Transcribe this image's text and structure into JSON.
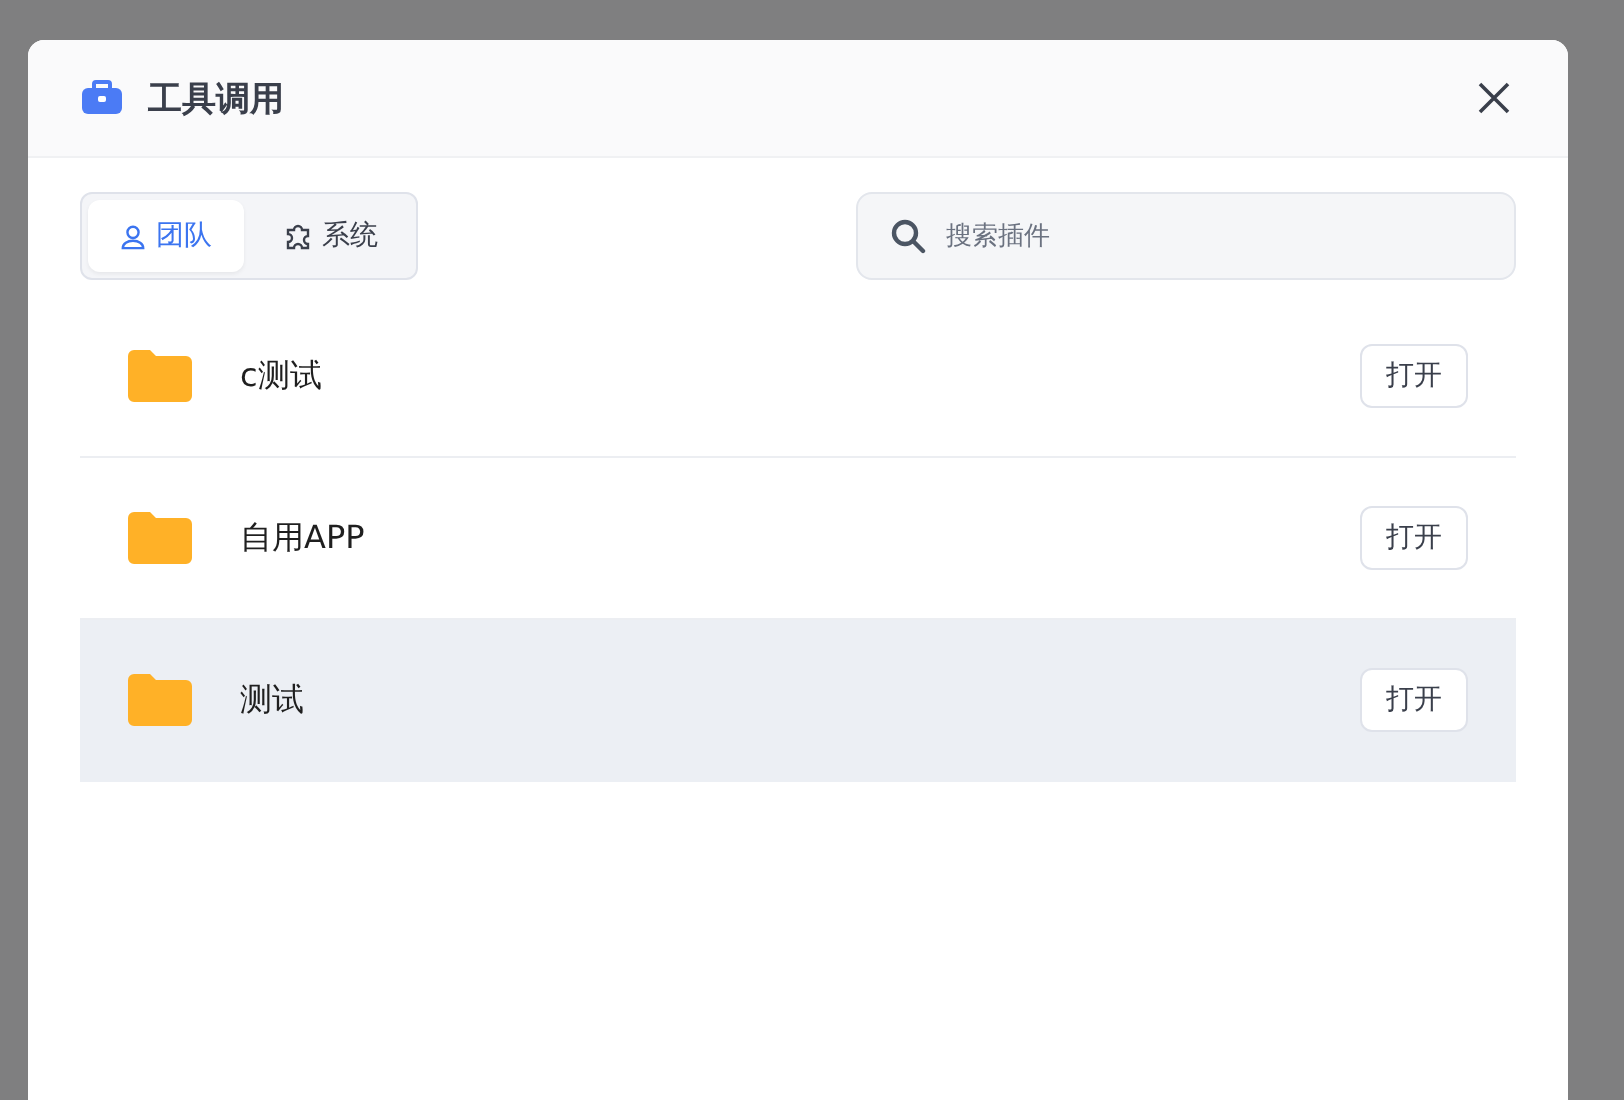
{
  "dialog": {
    "title": "工具调用"
  },
  "tabs": [
    {
      "label": "团队",
      "kind": "team",
      "selected": true
    },
    {
      "label": "系统",
      "kind": "system",
      "selected": false
    }
  ],
  "search": {
    "placeholder": "搜索插件"
  },
  "folders": [
    {
      "name": "c测试",
      "action": "打开",
      "selected": false
    },
    {
      "name": "自用APP",
      "action": "打开",
      "selected": false
    },
    {
      "name": "测试",
      "action": "打开",
      "selected": true
    }
  ]
}
